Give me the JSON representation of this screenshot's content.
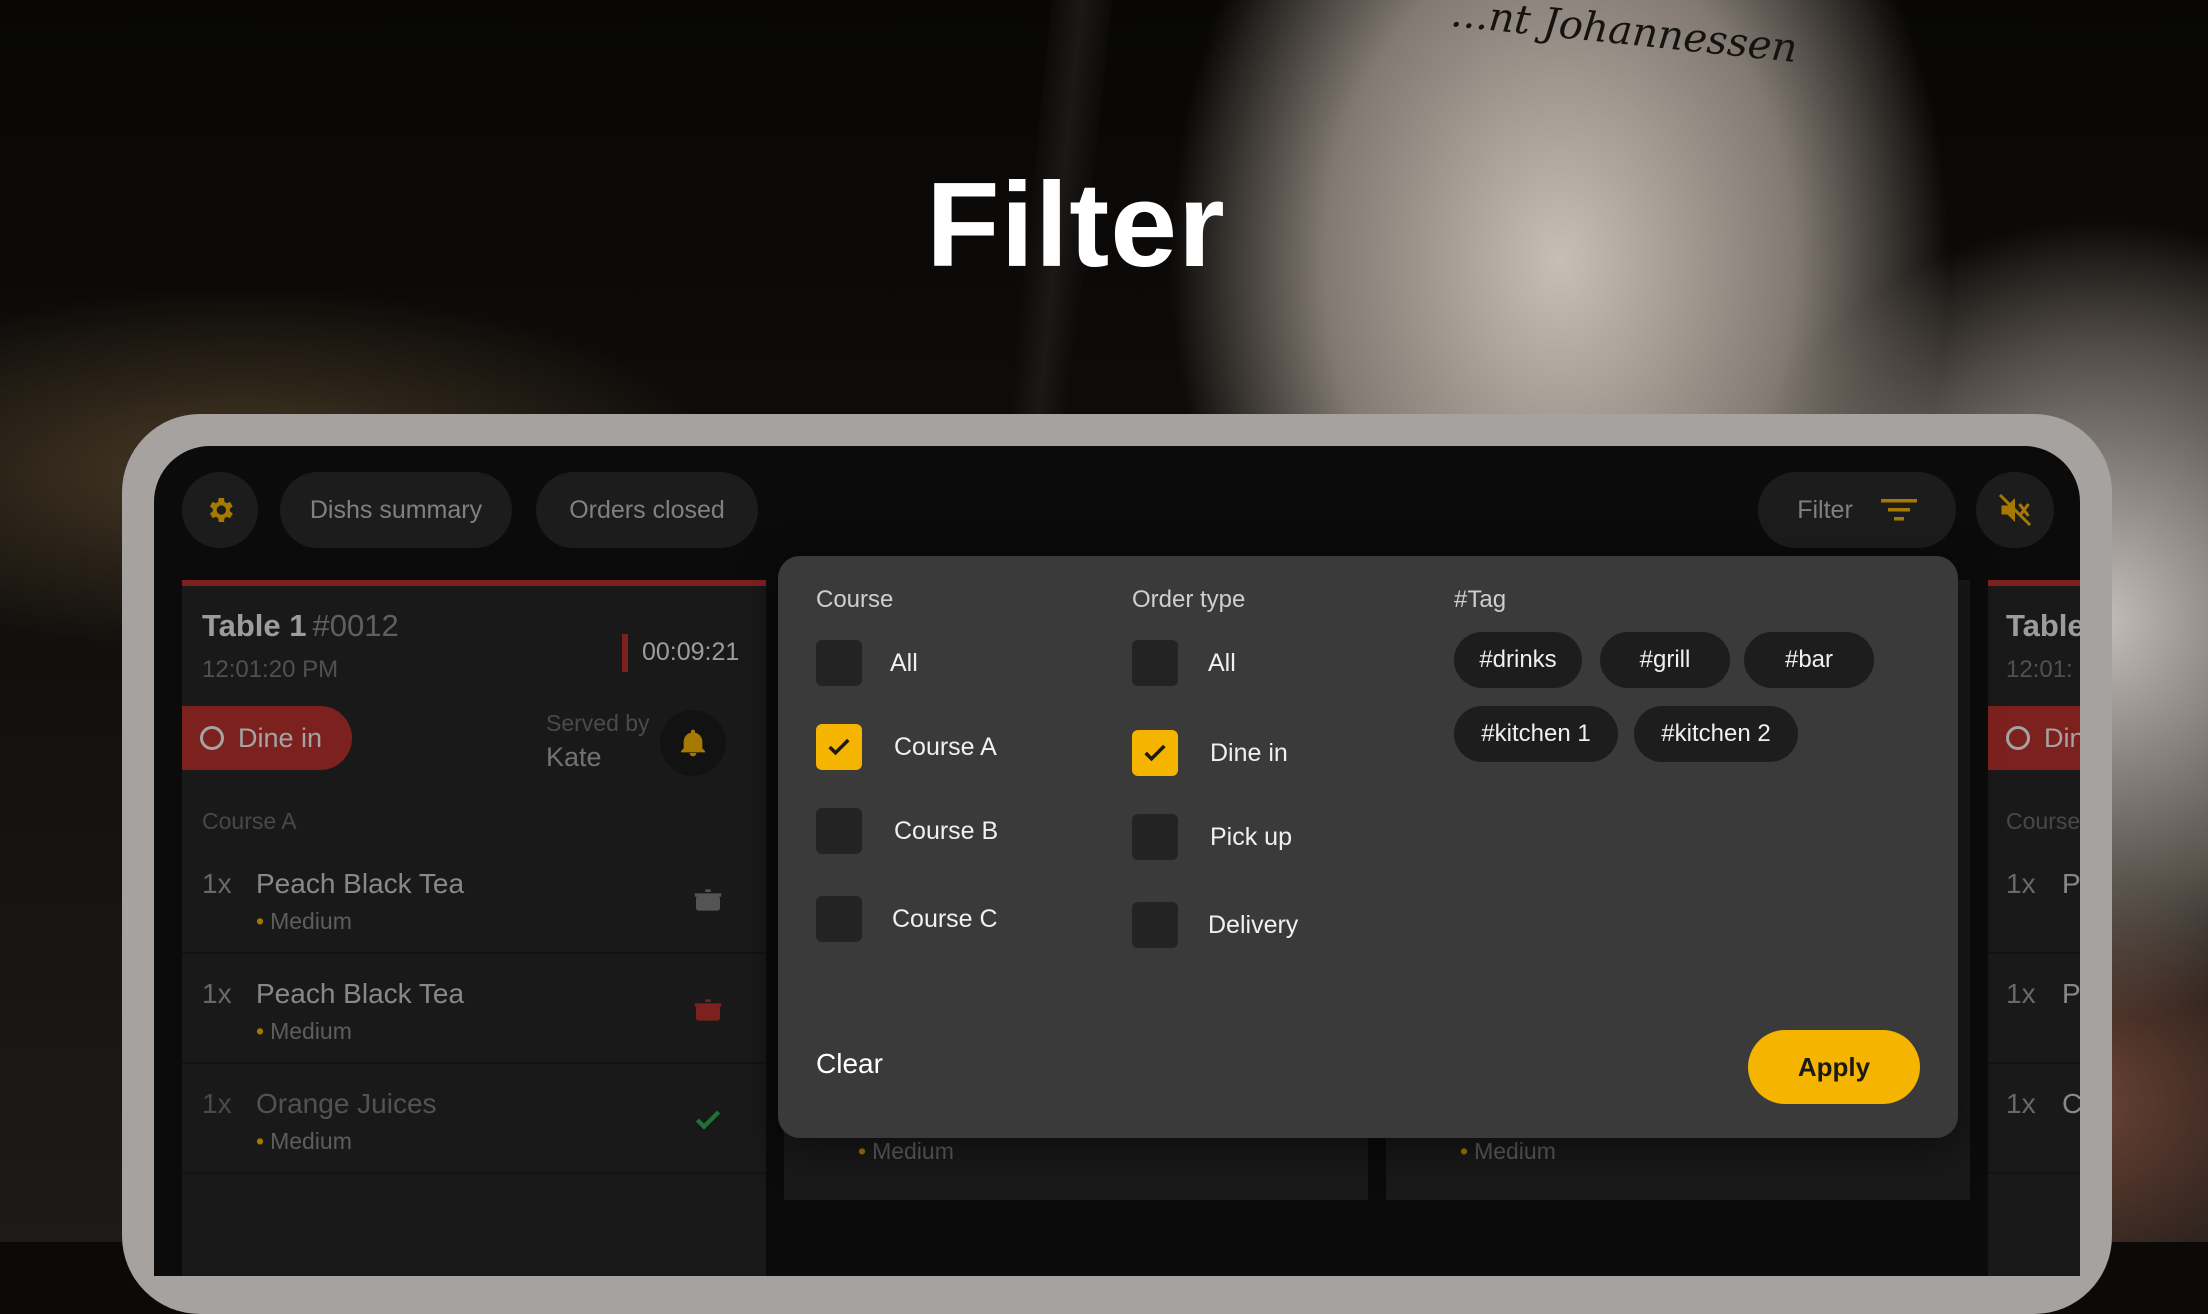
{
  "headline": "Filter",
  "background_tattoo": "...nt Johannessen",
  "topbar": {
    "dishes_label": "Dishs summary",
    "closed_label": "Orders closed",
    "filter_label": "Filter"
  },
  "order": {
    "table": "Table 1",
    "number": "#0012",
    "time": "12:01:20 PM",
    "timer": "00:09:21",
    "type": "Dine in",
    "served_by_label": "Served by",
    "served_by": "Kate",
    "course": "Course A",
    "items": [
      {
        "qty": "1x",
        "name": "Peach Black Tea",
        "modifier": "Medium",
        "status": "cooking-pot-icon"
      },
      {
        "qty": "1x",
        "name": "Peach Black Tea",
        "modifier": "Medium",
        "status": "cooking-pot-red-icon"
      },
      {
        "qty": "1x",
        "name": "Orange Juices",
        "modifier": "Medium",
        "status": "check-icon"
      }
    ]
  },
  "order_partial": {
    "table": "Table",
    "time": "12:01:",
    "type": "Din",
    "course": "Course",
    "qtys": [
      "1x",
      "1x",
      "1x"
    ],
    "initials": [
      "P",
      "P",
      "C"
    ]
  },
  "hidden_rows": {
    "col2_modifier": "Medium",
    "col3_modifier": "Medium"
  },
  "filter": {
    "course_heading": "Course",
    "course_options": [
      {
        "label": "All",
        "checked": false
      },
      {
        "label": "Course A",
        "checked": true
      },
      {
        "label": "Course B",
        "checked": false
      },
      {
        "label": "Course C",
        "checked": false
      }
    ],
    "order_type_heading": "Order type",
    "order_type_options": [
      {
        "label": "All",
        "checked": false
      },
      {
        "label": "Dine in",
        "checked": true
      },
      {
        "label": "Pick up",
        "checked": false
      },
      {
        "label": "Delivery",
        "checked": false
      }
    ],
    "tag_heading": "#Tag",
    "tags": [
      "#drinks",
      "#grill",
      "#bar",
      "#kitchen 1",
      "#kitchen 2"
    ],
    "clear_label": "Clear",
    "apply_label": "Apply"
  },
  "colors": {
    "accent": "#f5b400",
    "alert_red": "#b8312f",
    "success_green": "#2fa84f"
  }
}
